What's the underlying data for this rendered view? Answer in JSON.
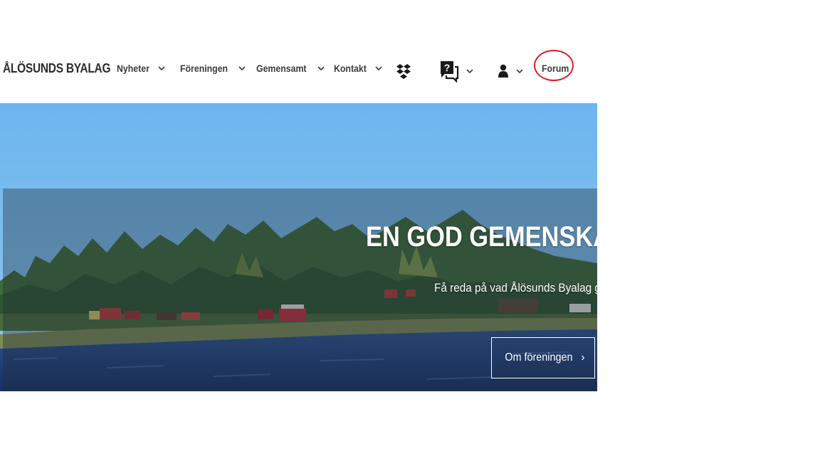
{
  "header": {
    "brand": "ÅLÖSUNDS BYALAG",
    "nav": [
      {
        "label": "Nyheter"
      },
      {
        "label": "Föreningen"
      },
      {
        "label": "Gemensamt"
      },
      {
        "label": "Kontakt"
      }
    ],
    "icons": {
      "dropbox": "dropbox-icon",
      "help": "help-chat-icon",
      "user": "user-icon"
    },
    "forum_label": "Forum"
  },
  "hero": {
    "title": "EN GOD GEMENSKAP",
    "subtitle": "Få reda på vad Ålösunds Byalag gör",
    "button_label": "Om föreningen",
    "button_chevron": "›"
  },
  "colors": {
    "highlight_ring": "#d9212a",
    "sky": "#66b4ee",
    "water": "#23457f"
  }
}
